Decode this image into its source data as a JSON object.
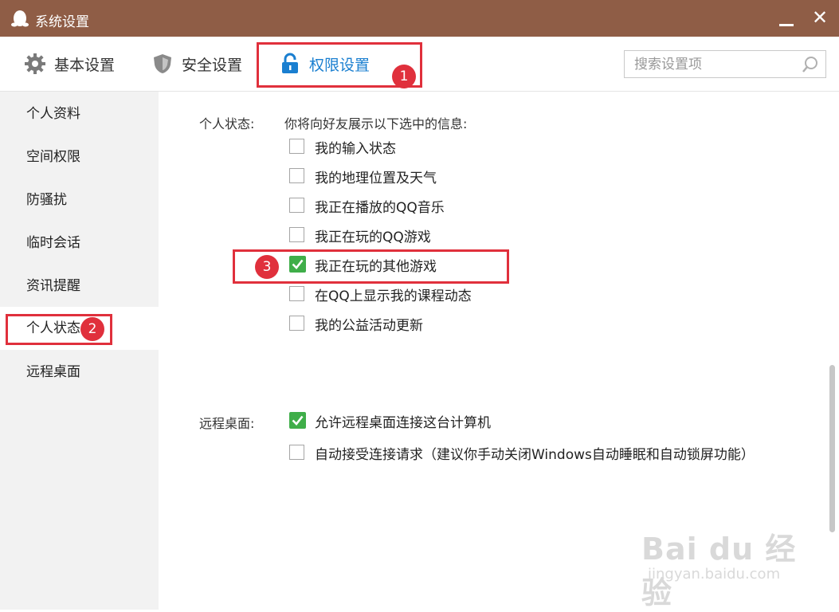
{
  "window": {
    "title": "系统设置",
    "minimize_icon": "minimize-icon",
    "close_label": "✕"
  },
  "tabs": [
    {
      "label": "基本设置",
      "icon": "gear-icon"
    },
    {
      "label": "安全设置",
      "icon": "shield-icon"
    },
    {
      "label": "权限设置",
      "icon": "lock-icon",
      "active": true
    }
  ],
  "search": {
    "placeholder": "搜索设置项",
    "icon": "search-icon"
  },
  "sidebar": {
    "items": [
      {
        "label": "个人资料"
      },
      {
        "label": "空间权限"
      },
      {
        "label": "防骚扰"
      },
      {
        "label": "临时会话"
      },
      {
        "label": "资讯提醒"
      },
      {
        "label": "个人状态",
        "active": true
      },
      {
        "label": "远程桌面"
      }
    ]
  },
  "personal_status": {
    "section_label": "个人状态:",
    "description": "你将向好友展示以下选中的信息:",
    "options": [
      {
        "label": "我的输入状态",
        "checked": false
      },
      {
        "label": "我的地理位置及天气",
        "checked": false
      },
      {
        "label": "我正在播放的QQ音乐",
        "checked": false
      },
      {
        "label": "我正在玩的QQ游戏",
        "checked": false
      },
      {
        "label": "我正在玩的其他游戏",
        "checked": true
      },
      {
        "label": "在QQ上显示我的课程动态",
        "checked": false
      },
      {
        "label": "我的公益活动更新",
        "checked": false
      }
    ]
  },
  "remote_desktop": {
    "section_label": "远程桌面:",
    "options": [
      {
        "label": "允许远程桌面连接这台计算机",
        "checked": true
      },
      {
        "label": "自动接受连接请求（建议你手动关闭Windows自动睡眠和自动锁屏功能）",
        "checked": false
      }
    ]
  },
  "annotations": {
    "badge1": "1",
    "badge2": "2",
    "badge3": "3"
  },
  "watermark": {
    "line1": "Bai du 经验",
    "line2": "jingyan.baidu.com"
  },
  "colors": {
    "titlebar": "#8f5d46",
    "accent": "#1a7fd0",
    "annotation": "#e0303c",
    "checkbox_checked": "#3fae49"
  }
}
